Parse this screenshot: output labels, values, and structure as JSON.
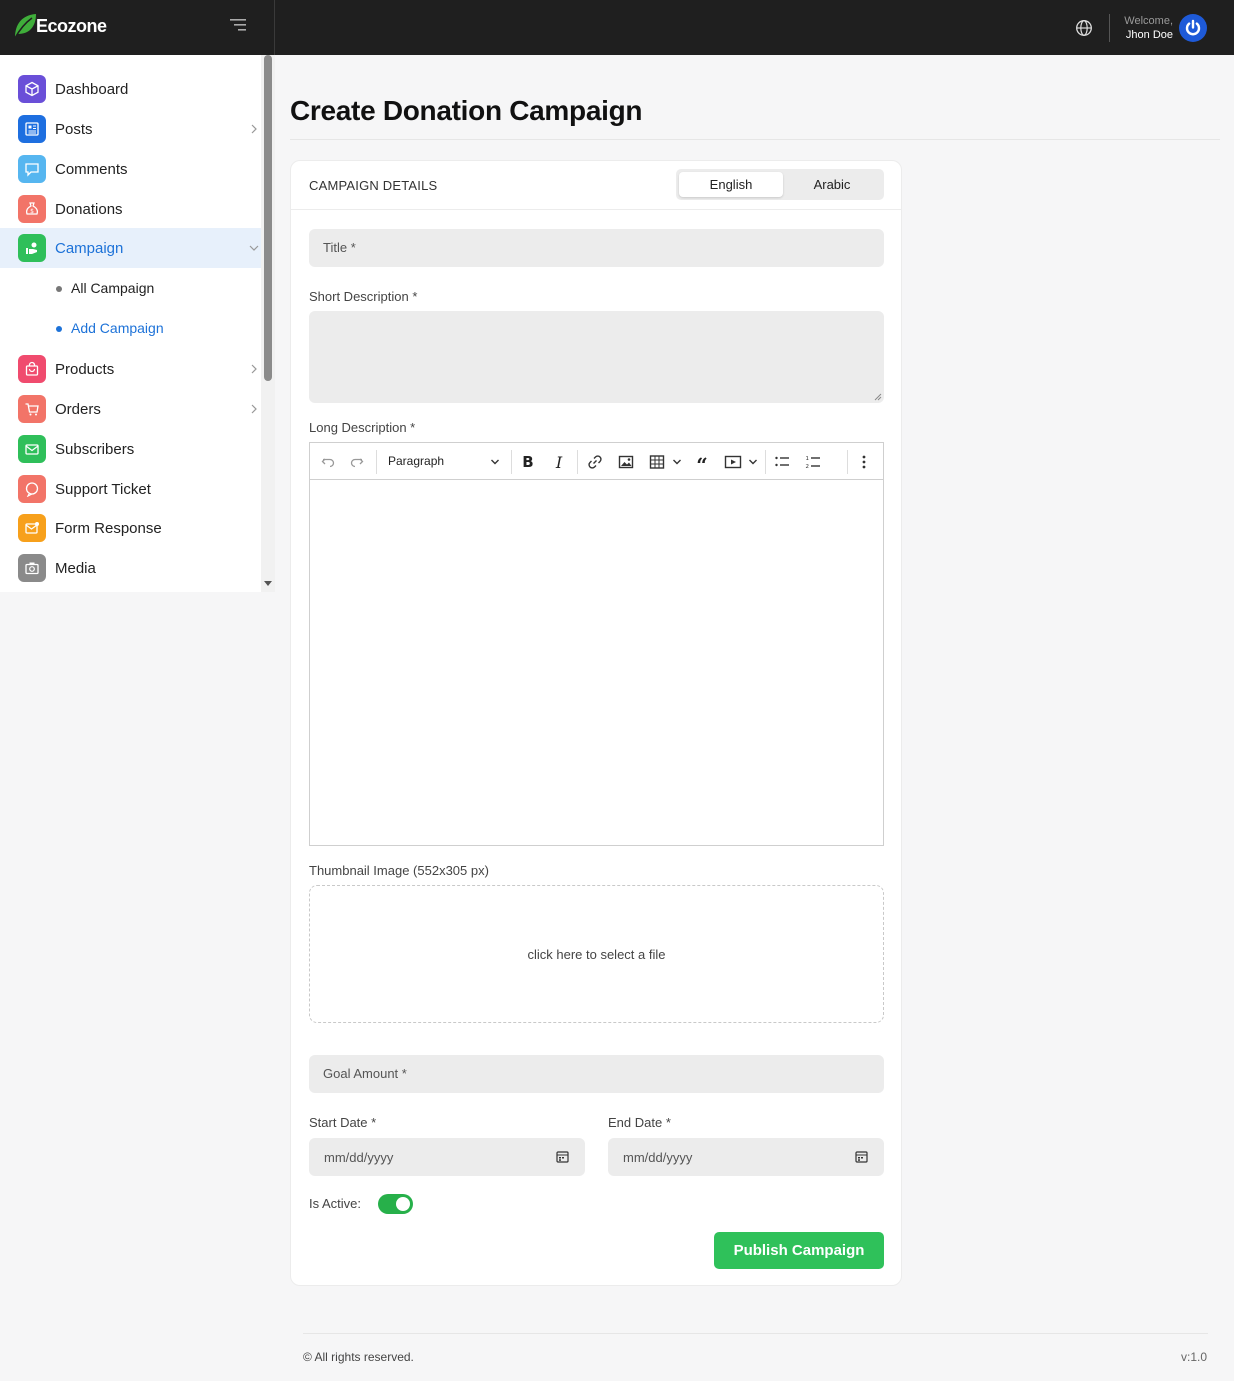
{
  "brand": {
    "name": "Ecozone"
  },
  "header": {
    "welcome": "Welcome,",
    "user_name": "Jhon Doe"
  },
  "sidebar": {
    "items": [
      {
        "label": "Dashboard",
        "icon": "cube-icon",
        "color": "#6a4fd8"
      },
      {
        "label": "Posts",
        "icon": "newspaper-icon",
        "color": "#1e6fe0"
      },
      {
        "label": "Comments",
        "icon": "chat-icon",
        "color": "#56b6f0"
      },
      {
        "label": "Donations",
        "icon": "money-bag-icon",
        "color": "#f27468"
      },
      {
        "label": "Campaign",
        "icon": "hand-heart-icon",
        "color": "#2fbf5a"
      },
      {
        "label": "Products",
        "icon": "shopping-bag-icon",
        "color": "#f04b6e"
      },
      {
        "label": "Orders",
        "icon": "cart-icon",
        "color": "#f27468"
      },
      {
        "label": "Subscribers",
        "icon": "envelope-icon",
        "color": "#2fbf5a"
      },
      {
        "label": "Support Ticket",
        "icon": "support-icon",
        "color": "#f27468"
      },
      {
        "label": "Form Response",
        "icon": "mail-notify-icon",
        "color": "#f7a01b"
      },
      {
        "label": "Media",
        "icon": "camera-icon",
        "color": "#8a8a8a"
      }
    ],
    "sub_items": [
      {
        "label": "All Campaign"
      },
      {
        "label": "Add Campaign"
      }
    ]
  },
  "page": {
    "title": "Create Donation Campaign"
  },
  "form": {
    "section_title": "CAMPAIGN DETAILS",
    "languages": [
      "English",
      "Arabic"
    ],
    "title_placeholder": "Title *",
    "short_desc_label": "Short Description *",
    "long_desc_label": "Long Description *",
    "editor_block_format": "Paragraph",
    "thumbnail_label": "Thumbnail Image (552x305 px)",
    "thumbnail_prompt": "click here to select a file",
    "goal_placeholder": "Goal Amount *",
    "start_label": "Start Date *",
    "end_label": "End Date *",
    "date_placeholder": "mm/dd/yyyy",
    "active_label": "Is Active:",
    "is_active": true,
    "submit_label": "Publish Campaign"
  },
  "footer": {
    "copyright": "© All rights reserved.",
    "version": "v:1.0"
  },
  "colors": {
    "accent": "#1d72d8",
    "success": "#2fc15a",
    "topbar": "#1f1f1f"
  }
}
